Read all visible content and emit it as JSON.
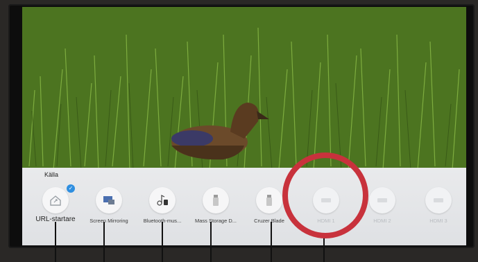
{
  "source_panel": {
    "title": "Källa",
    "items": [
      {
        "label": "URL-startare",
        "icon": "home-icon",
        "selected": true
      },
      {
        "label": "Screen Mirroring",
        "icon": "screen-mirroring-icon"
      },
      {
        "label": "Bluetooth-mus...",
        "icon": "bluetooth-audio-icon"
      },
      {
        "label": "Mass Storage D...",
        "icon": "usb-storage-icon"
      },
      {
        "label": "Cruzer Blade",
        "icon": "usb-drive-icon"
      },
      {
        "label": "HDMI 1",
        "icon": "hdmi-icon",
        "dimmed": true
      },
      {
        "label": "HDMI 2",
        "icon": "hdmi-icon",
        "dimmed": true
      },
      {
        "label": "HDMI 3",
        "icon": "hdmi-icon",
        "dimmed": true
      }
    ]
  },
  "colors": {
    "highlight": "#c8323c",
    "check": "#2f8fe0"
  }
}
